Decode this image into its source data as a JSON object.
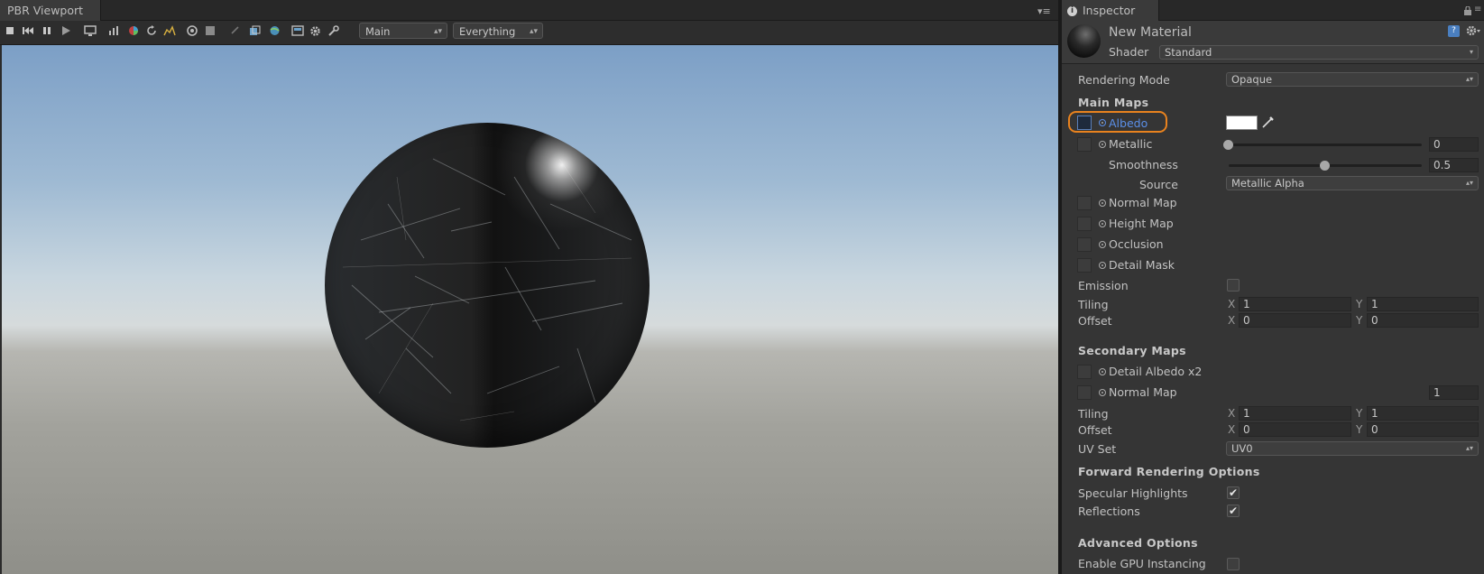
{
  "viewport": {
    "tab_title": "PBR Viewport",
    "menu_glyph": "▾≡",
    "camera_dropdown": "Main",
    "layer_dropdown": "Everything"
  },
  "inspector": {
    "tab_title": "Inspector",
    "material_name": "New Material",
    "shader_label": "Shader",
    "shader_value": "Standard",
    "rendering_mode_label": "Rendering Mode",
    "rendering_mode_value": "Opaque",
    "main_maps": {
      "heading": "Main Maps",
      "albedo": "Albedo",
      "metallic": "Metallic",
      "metallic_value": "0",
      "metallic_level": 0.0,
      "smoothness": "Smoothness",
      "smoothness_value": "0.5",
      "smoothness_level": 0.5,
      "source_label": "Source",
      "source_value": "Metallic Alpha",
      "normal_map": "Normal Map",
      "height_map": "Height Map",
      "occlusion": "Occlusion",
      "detail_mask": "Detail Mask",
      "emission": "Emission",
      "tiling_label": "Tiling",
      "tiling_x": "1",
      "tiling_y": "1",
      "offset_label": "Offset",
      "offset_x": "0",
      "offset_y": "0"
    },
    "secondary_maps": {
      "heading": "Secondary Maps",
      "detail_albedo": "Detail Albedo x2",
      "normal_map": "Normal Map",
      "normal_scale": "1",
      "tiling_label": "Tiling",
      "tiling_x": "1",
      "tiling_y": "1",
      "offset_label": "Offset",
      "offset_x": "0",
      "offset_y": "0",
      "uv_set_label": "UV Set",
      "uv_set_value": "UV0"
    },
    "forward": {
      "heading": "Forward Rendering Options",
      "specular_highlights": "Specular Highlights",
      "reflections": "Reflections"
    },
    "advanced": {
      "heading": "Advanced Options",
      "gpu_instancing": "Enable GPU Instancing"
    },
    "axis_x": "X",
    "axis_y": "Y",
    "check_glyph": "✔"
  },
  "colors": {
    "highlight": "#e8821e",
    "albedo_text": "#5b8fe8",
    "albedo_swatch": "#ffffff"
  }
}
